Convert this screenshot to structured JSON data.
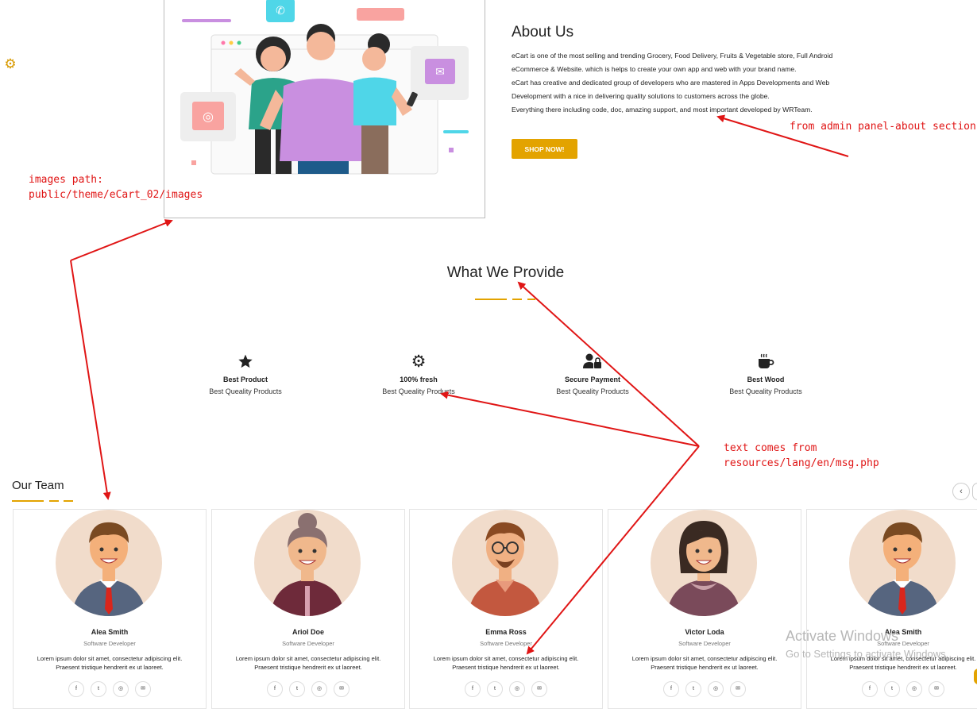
{
  "about": {
    "title": "About Us",
    "lines": [
      "eCart is one of the most selling and trending  Grocery, Food Delivery, Fruits & Vegetable store, Full Android",
      "eCommerce & Website. which is helps to create your own app and web with your brand name.",
      "eCart has creative and dedicated group of developers who are mastered in Apps Developments and Web",
      "Development with a nice in delivering quality solutions to customers across the globe.",
      "Everything there including code, doc, amazing support, and most important developed by WRTeam."
    ],
    "button": "SHOP NOW!"
  },
  "provide": {
    "title": "What We Provide",
    "features": [
      {
        "icon": "star-icon",
        "title": "Best Product",
        "subtitle": "Best Queality Products"
      },
      {
        "icon": "gear-icon",
        "title": "100% fresh",
        "subtitle": "Best Queality Products"
      },
      {
        "icon": "user-lock-icon",
        "title": "Secure Payment",
        "subtitle": "Best Queality Products"
      },
      {
        "icon": "coffee-icon",
        "title": "Best Wood",
        "subtitle": "Best Queality Products"
      }
    ]
  },
  "annotations": {
    "admin": "from admin panel-about section",
    "images_1": "images path:",
    "images_2": "public/theme/eCart_02/images",
    "lang_1": "text comes from",
    "lang_2": "resources/lang/en/msg.php"
  },
  "team": {
    "title": "Our Team",
    "prev": "‹",
    "members": [
      {
        "name": "Alea Smith",
        "role": "Software Developer",
        "desc1": "Lorem ipsum dolor sit amet, consectetur adipiscing elit.",
        "desc2": "Praesent tristique hendrerit ex ut laoreet."
      },
      {
        "name": "Ariol Doe",
        "role": "Software Developer",
        "desc1": "Lorem ipsum dolor sit amet, consectetur adipiscing elit.",
        "desc2": "Praesent tristique hendrerit ex ut laoreet."
      },
      {
        "name": "Emma Ross",
        "role": "Software Developer",
        "desc1": "Lorem ipsum dolor sit amet, consectetur adipiscing elit.",
        "desc2": "Praesent tristique hendrerit ex ut laoreet."
      },
      {
        "name": "Victor Loda",
        "role": "Software Developer",
        "desc1": "Lorem ipsum dolor sit amet, consectetur adipiscing elit.",
        "desc2": "Praesent tristique hendrerit ex ut laoreet."
      },
      {
        "name": "Alea Smith",
        "role": "Software Developer",
        "desc1": "Lorem ipsum dolor sit amet, consectetur adipiscing elit.",
        "desc2": "Praesent tristique hendrerit ex ut laoreet."
      }
    ],
    "social": [
      "f",
      "t",
      "◎",
      "✉"
    ]
  },
  "watermark": {
    "line1": "Activate Windows",
    "line2": "Go to Settings to activate Windows."
  },
  "colors": {
    "accent": "#e3a300",
    "annotation": "#e01515"
  }
}
